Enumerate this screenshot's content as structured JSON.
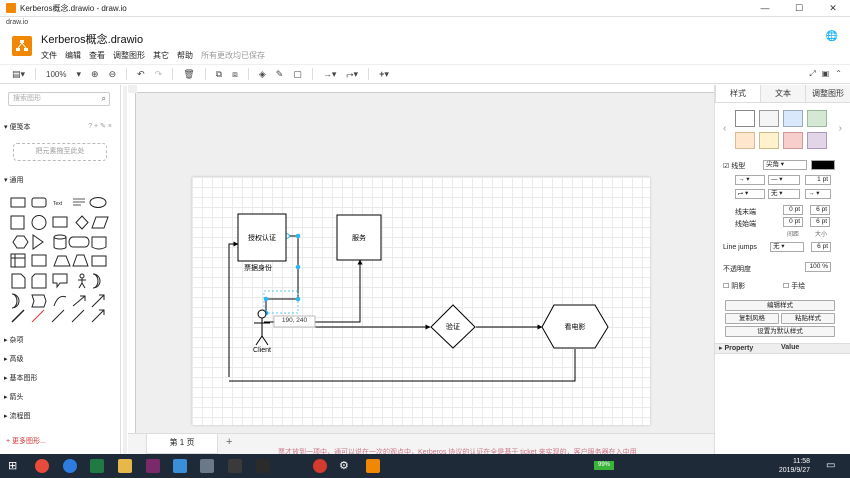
{
  "window": {
    "title": "Kerberos概念.drawio - draw.io",
    "url_label": "draw.io"
  },
  "header": {
    "doc_title": "Kerberos概念.drawio",
    "menu": [
      "文件",
      "编辑",
      "查看",
      "调整图形",
      "其它",
      "帮助"
    ],
    "save_status": "所有更改均已保存"
  },
  "toolbar": {
    "zoom": "100%"
  },
  "sidebar": {
    "search_placeholder": "搜索图形",
    "scratchpad_title": "便笺本",
    "scratchpad_tools": "? + ✎ ×",
    "scratch_drop": "把元素拖至此处",
    "general_title": "通用",
    "sections": [
      "杂项",
      "高级",
      "基本图形",
      "箭头",
      "流程图"
    ],
    "more_shapes": "+ 更多图形..."
  },
  "diagram": {
    "auth_box": "授权认证",
    "auth_label": "票据身份",
    "service_box": "服务",
    "verify": "验证",
    "movie": "看电影",
    "client": "Client",
    "coords": "190, 240"
  },
  "pages": {
    "tab": "第 1 页"
  },
  "format_panel": {
    "tabs": [
      "样式",
      "文本",
      "调整图形"
    ],
    "line_label": "线型",
    "line_style": "尖角",
    "line_width": "1 pt",
    "arrow_start": "无",
    "line_start_label": "线末端",
    "line_end_label": "线始端",
    "spacing_label": "间距",
    "size_label": "大小",
    "start_spacing": "0 pt",
    "start_size": "6 pt",
    "end_spacing": "0 pt",
    "end_size": "6 pt",
    "line_jumps": "Line jumps",
    "jumps_value": "无",
    "jumps_size": "6 pt",
    "opacity_label": "不透明度",
    "opacity_value": "100 %",
    "shadow": "阴影",
    "sketch": "手绘",
    "edit_style": "编辑样式",
    "copy_style": "复制风格",
    "paste_style": "粘贴样式",
    "set_default": "设置为默认样式",
    "property": "Property",
    "value": "Value"
  },
  "taskbar": {
    "battery": "99%",
    "time": "11:58",
    "date": "2019/9/27",
    "overlay_text": "票才放到一项中，通可以说在一次的观点中，Kerberos 协议的认证在全是基于 ticket 来实现的，客户服务器在入中用"
  },
  "colors": {
    "accent": "#f08705",
    "selection": "#29b6f2",
    "taskbar": "#1f2a38"
  }
}
